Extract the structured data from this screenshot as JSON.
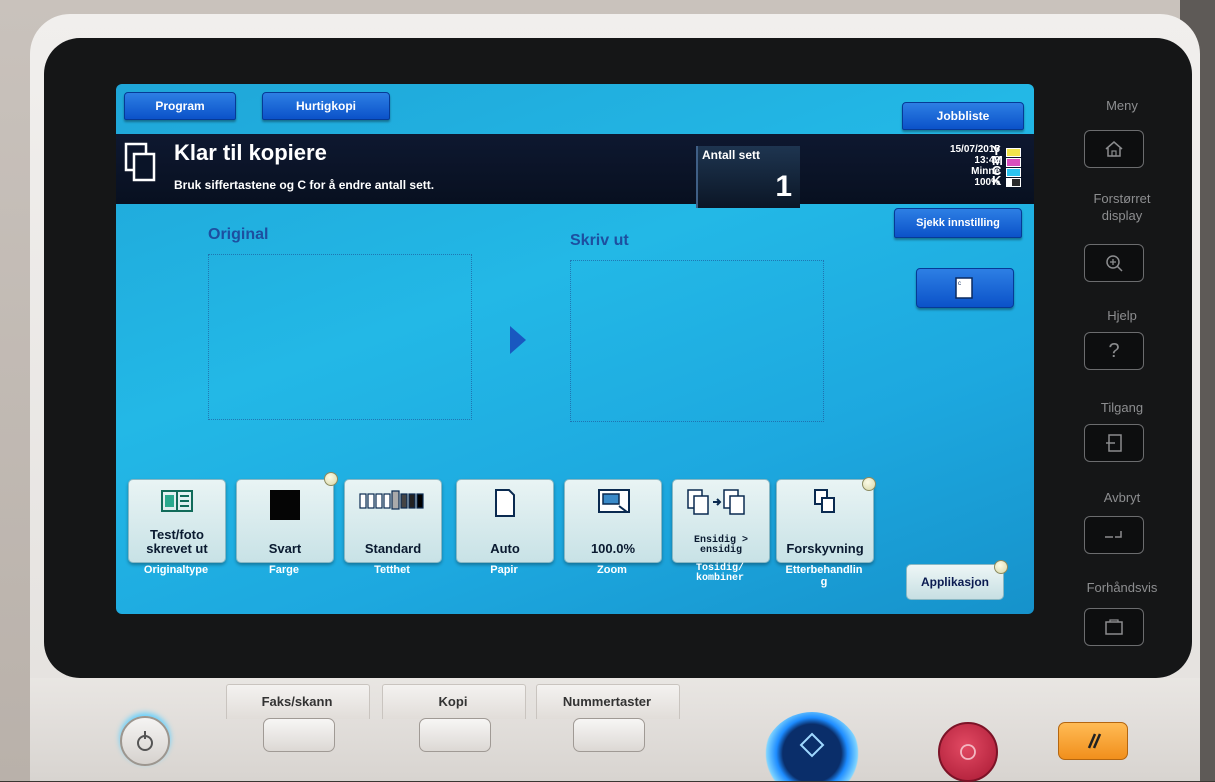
{
  "screen": {
    "tabs": [
      "Program",
      "Hurtigkopi",
      "Jobbliste"
    ],
    "header": {
      "title": "Klar til kopiere",
      "subtitle": "Bruk siffertastene og C for å endre antall sett.",
      "antall_label": "Antall sett",
      "antall_value": "1",
      "status": {
        "date": "15/07/2015",
        "time": "13:42",
        "memory_label": "Minne",
        "memory_value": "100%",
        "toner": [
          {
            "letter": "Y",
            "color": "#f2e44c"
          },
          {
            "letter": "M",
            "color": "#d84fbd"
          },
          {
            "letter": "C",
            "color": "#2cc4f0"
          },
          {
            "letter": "K",
            "color": "#2a2a2a"
          }
        ]
      }
    },
    "check_settings_label": "Sjekk innstilling",
    "preview": {
      "original_label": "Original",
      "output_label": "Skriv ut"
    },
    "functions": [
      {
        "button": "Test/foto\nskrevet ut",
        "caption": "Originaltype",
        "icon": "original-type-icon"
      },
      {
        "button": "Svart",
        "caption": "Farge",
        "icon": "color-black-icon"
      },
      {
        "button": "Standard",
        "caption": "Tetthet",
        "icon": "density-icon"
      },
      {
        "button": "Auto",
        "caption": "Papir",
        "icon": "paper-icon"
      },
      {
        "button": "100.0%",
        "caption": "Zoom",
        "icon": "zoom-icon"
      },
      {
        "button": "Ensidig >\nensidig",
        "caption": "Tosidig/\nkombiner",
        "icon": "duplex-icon"
      },
      {
        "button": "Forskyvning",
        "caption": "Etterbehandlin\ng",
        "icon": "finishing-icon"
      }
    ],
    "application_label": "Applikasjon"
  },
  "device": {
    "side_buttons": [
      {
        "label": "Meny",
        "icon": "home-icon"
      },
      {
        "label": "Forstørret\ndisplay",
        "icon": "zoom-in-icon"
      },
      {
        "label": "Hjelp",
        "icon": "help-icon"
      },
      {
        "label": "Tilgang",
        "icon": "access-icon"
      },
      {
        "label": "Avbryt",
        "icon": "interrupt-icon"
      },
      {
        "label": "Forhåndsvis",
        "icon": "preview-icon"
      }
    ],
    "bottom_buttons": [
      "Faks/skann",
      "Kopi",
      "Nummertaster"
    ]
  }
}
